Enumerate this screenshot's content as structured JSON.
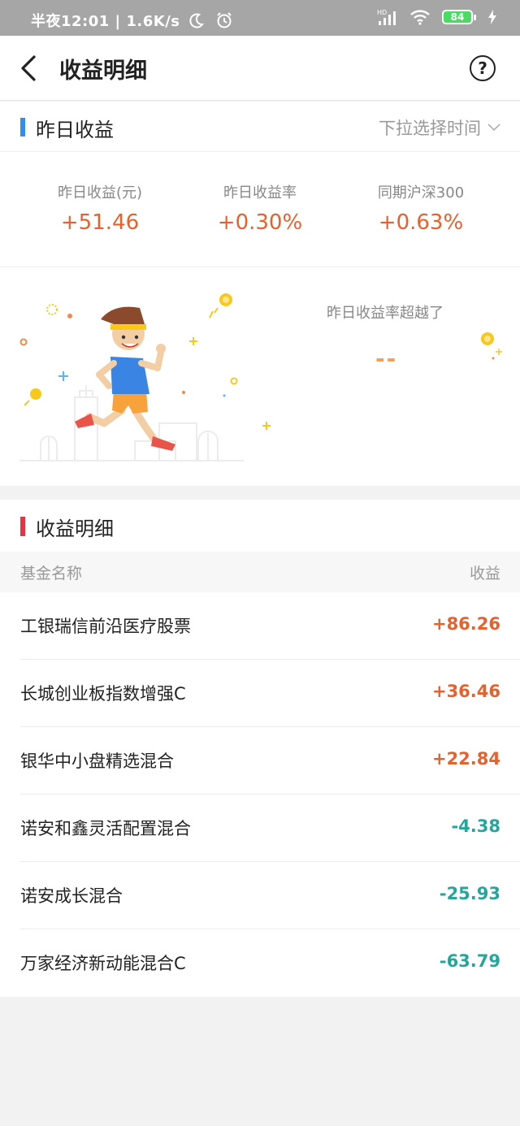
{
  "status_bar": {
    "left_text": "半夜12:01 | 1.6K/s",
    "battery": "84"
  },
  "nav": {
    "title": "收益明细"
  },
  "yesterday": {
    "section_title": "昨日收益",
    "dropdown_label": "下拉选择时间",
    "stats": [
      {
        "label": "昨日收益(元)",
        "value": "+51.46"
      },
      {
        "label": "昨日收益率",
        "value": "+0.30%"
      },
      {
        "label": "同期沪深300",
        "value": "+0.63%"
      }
    ],
    "beat_text": "昨日收益率超越了",
    "beat_value": "--"
  },
  "detail": {
    "section_title": "收益明细",
    "col_name": "基金名称",
    "col_profit": "收益",
    "rows": [
      {
        "name": "工银瑞信前沿医疗股票",
        "value": "+86.26",
        "sign": "pos"
      },
      {
        "name": "长城创业板指数增强C",
        "value": "+36.46",
        "sign": "pos"
      },
      {
        "name": "银华中小盘精选混合",
        "value": "+22.84",
        "sign": "pos"
      },
      {
        "name": "诺安和鑫灵活配置混合",
        "value": "-4.38",
        "sign": "neg"
      },
      {
        "name": "诺安成长混合",
        "value": "-25.93",
        "sign": "neg"
      },
      {
        "name": "万家经济新动能混合C",
        "value": "-63.79",
        "sign": "neg"
      }
    ]
  },
  "colors": {
    "accent_blue": "#2f8fec",
    "accent_red": "#e8343f",
    "positive": "#e8602c",
    "negative": "#24a69a"
  }
}
